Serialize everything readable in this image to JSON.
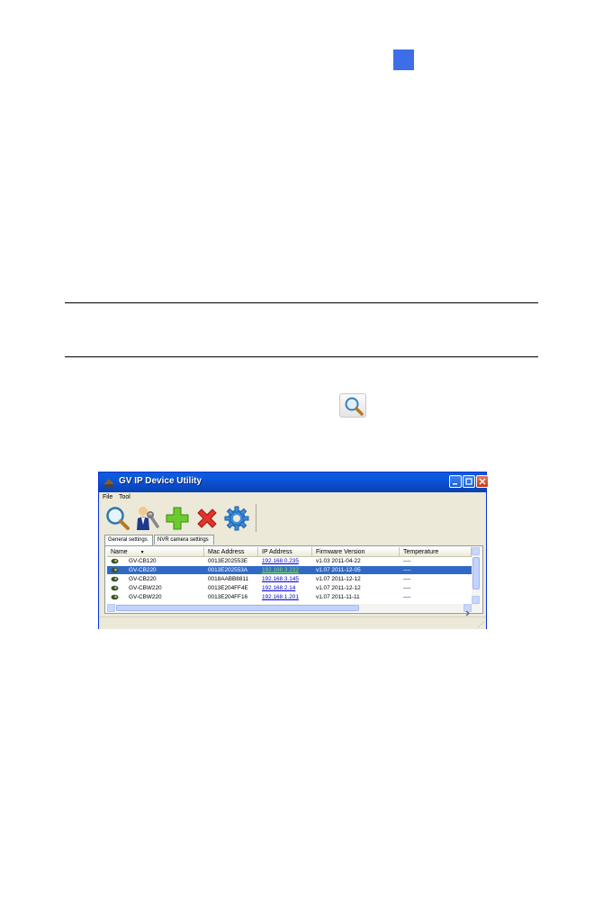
{
  "page": {
    "marker_color": "#3d6ee8",
    "inline_icon": "search-icon"
  },
  "window": {
    "title": "GV IP Device Utility",
    "menu": [
      "File",
      "Tool"
    ],
    "toolbar": [
      {
        "name": "search-icon",
        "label": "Search"
      },
      {
        "name": "user-settings-icon",
        "label": "Settings"
      },
      {
        "name": "add-icon",
        "label": "Add"
      },
      {
        "name": "delete-icon",
        "label": "Delete"
      },
      {
        "name": "gear-icon",
        "label": "Config"
      }
    ],
    "tabs": [
      "General settings",
      "NVR camera settings"
    ],
    "columns": [
      "Name",
      "Mac Address",
      "IP Address",
      "Firmware Version",
      "Temperature"
    ],
    "sort_indicator": "▼",
    "rows": [
      {
        "name": "GV-CB120",
        "mac": "0013E202553E",
        "ip": "192.168.0.235",
        "fw": "v1.03  2011-04-22",
        "temp": "----"
      },
      {
        "name": "GV-CB220",
        "mac": "0013E202553A",
        "ip": "192.168.3.232",
        "fw": "v1.07  2011-12-05",
        "temp": "----"
      },
      {
        "name": "GV-CB220",
        "mac": "0018AABB8811",
        "ip": "192.168.3.145",
        "fw": "v1.07  2011-12-12",
        "temp": "----"
      },
      {
        "name": "GV-CBW220",
        "mac": "0013E204FF4E",
        "ip": "192.168.2.14",
        "fw": "v1.07  2011-12-12",
        "temp": "----"
      },
      {
        "name": "GV-CBW220",
        "mac": "0013E204FF16",
        "ip": "192.168.1.201",
        "fw": "v1.07  2011-11-11",
        "temp": "----"
      }
    ],
    "selected_row": 1
  }
}
